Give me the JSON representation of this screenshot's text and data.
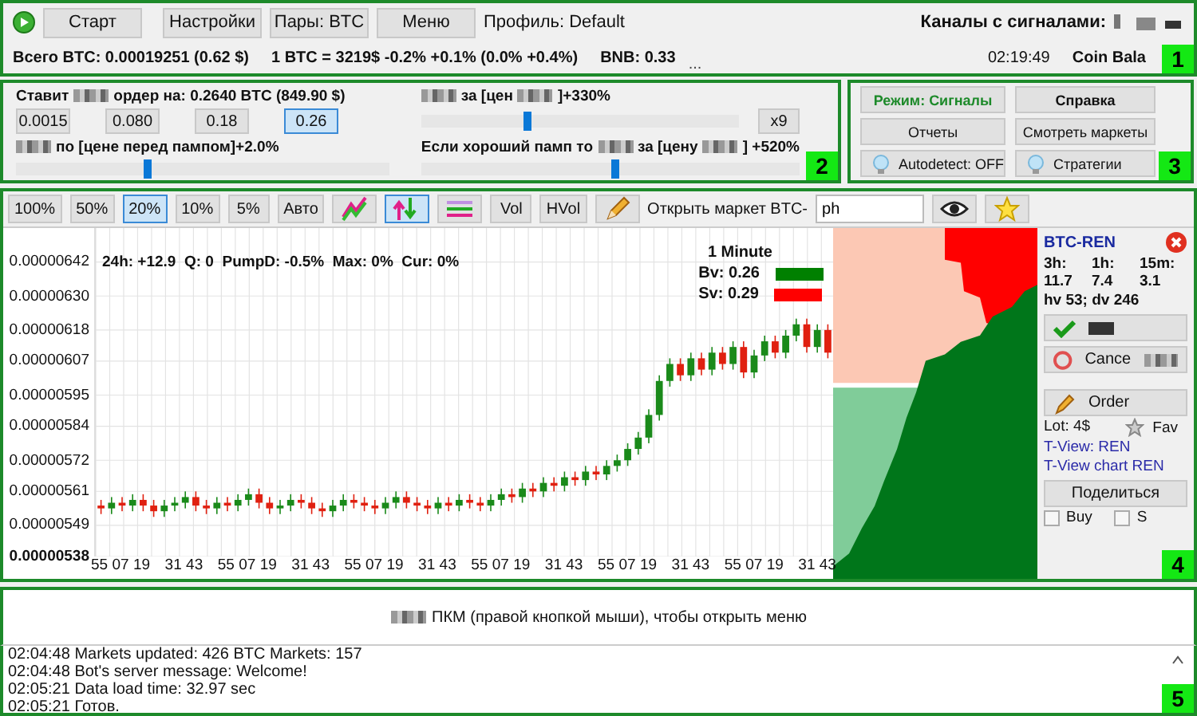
{
  "toolbar": {
    "buttons": [
      {
        "label": "Старт",
        "kind": "start"
      },
      {
        "label": "Настройки",
        "kind": "plain"
      },
      {
        "label": "Пары: BTC",
        "kind": "plain"
      },
      {
        "label": "Меню",
        "kind": "plain"
      }
    ],
    "profile": "Профиль: Default",
    "channels_label": "Каналы с сигналами:",
    "badge": "1"
  },
  "status_bar": {
    "items": [
      "Всего BTC: 0.00019251 (0.62 $)",
      "1 BTC = 3219$  -0.2% +0.1% (0.0% +0.4%)",
      "BNB: 0.33"
    ],
    "more": "...",
    "time": "02:19:49",
    "coin_balance": "Coin Bala"
  },
  "order_panel": {
    "amount_label": [
      {
        "kind": "text",
        "text": "Ставит"
      },
      {
        "kind": "redacted"
      },
      {
        "kind": "text",
        "text": "ордер на: 0.2640 BTC  (849.90 $)"
      }
    ],
    "amounts": [
      {
        "label": "0.0015",
        "selected": false
      },
      {
        "label": "0.080",
        "selected": false
      },
      {
        "label": "0.18",
        "selected": false
      },
      {
        "label": "0.26",
        "selected": true
      }
    ],
    "sell_label": [
      {
        "kind": "redacted"
      },
      {
        "kind": "text",
        "text": "по [цене перед пампом]+2.0%"
      }
    ],
    "sell_slider": {
      "level": 0.35
    },
    "target_label": [
      {
        "kind": "redacted"
      },
      {
        "kind": "text",
        "text": "за [цен"
      },
      {
        "kind": "redacted"
      },
      {
        "kind": "text",
        "text": "]+330%"
      }
    ],
    "target_slider": {
      "level": 0.33
    },
    "multiplier": "x9",
    "pump_label": [
      {
        "kind": "text",
        "text": "Если хороший памп  то"
      },
      {
        "kind": "redacted"
      },
      {
        "kind": "text",
        "text": "за [цену"
      },
      {
        "kind": "redacted"
      },
      {
        "kind": "text",
        "text": "] +520%"
      }
    ],
    "pump_slider": {
      "level": 0.51
    },
    "badge": "2"
  },
  "mode_panel": {
    "buttons": [
      {
        "label": "Режим: Сигналы",
        "kind": "mode"
      },
      {
        "label": "Справка",
        "kind": "bold"
      },
      {
        "label": "Отчеты",
        "kind": "plain"
      },
      {
        "label": "Смотреть маркеты",
        "kind": "plain"
      },
      {
        "label": "Autodetect: OFF",
        "kind": "bulb"
      },
      {
        "label": "Стратегии",
        "kind": "bulb"
      }
    ],
    "badge": "3"
  },
  "chart_toolbar": {
    "items": [
      {
        "kind": "text",
        "label": "100%",
        "selected": false
      },
      {
        "kind": "text",
        "label": "50%",
        "selected": false
      },
      {
        "kind": "text",
        "label": "20%",
        "selected": true
      },
      {
        "kind": "text",
        "label": "10%",
        "selected": false
      },
      {
        "kind": "text",
        "label": "5%",
        "selected": false
      },
      {
        "kind": "text",
        "label": "Авто",
        "selected": false
      },
      {
        "kind": "lines-icon",
        "selected": false
      },
      {
        "kind": "arrows-icon",
        "selected": true
      },
      {
        "kind": "bars-icon",
        "selected": false
      },
      {
        "kind": "bold",
        "label": "Vol",
        "selected": false
      },
      {
        "kind": "bold",
        "label": "HVol",
        "selected": false
      },
      {
        "kind": "pencil-icon",
        "selected": false
      }
    ],
    "open_market_label": "Открыть маркет BTC-",
    "market_value": "ph"
  },
  "chart": {
    "stats": "24h: +12.9  Q: 0  PumpD: -0.5%  Max: 0%  Cur: 0%",
    "interval": "1 Minute",
    "legend": [
      {
        "label": "Bv: 0.26",
        "color": "#008000"
      },
      {
        "label": "Sv: 0.29",
        "color": "#ff0000"
      }
    ],
    "chart_data": {
      "type": "candlestick",
      "grid": true,
      "ylim": [
        5.38e-06,
        6.54e-06
      ],
      "categories": [
        "55",
        null,
        "07",
        null,
        "19",
        null,
        null,
        "31",
        null,
        "43",
        null,
        null,
        "55",
        null,
        "07",
        null,
        "19",
        null,
        null,
        "31",
        null,
        "43",
        null,
        null,
        "55",
        null,
        "07",
        null,
        "19",
        null,
        null,
        "31",
        null,
        "43",
        null,
        null,
        "55",
        null,
        "07",
        null,
        "19",
        null,
        null,
        "31",
        null,
        "43",
        null,
        null,
        "55",
        null,
        "07",
        null,
        "19",
        null,
        null,
        "31",
        null,
        "43",
        null,
        null,
        "55",
        null,
        "07",
        null,
        "19",
        null,
        null,
        "31",
        null,
        "43"
      ],
      "ohlc": [
        [
          5.56e-06,
          5.58e-06,
          5.53e-06,
          5.55e-06
        ],
        [
          5.55e-06,
          5.59e-06,
          5.53e-06,
          5.57e-06
        ],
        [
          5.57e-06,
          5.59e-06,
          5.54e-06,
          5.56e-06
        ],
        [
          5.56e-06,
          5.6e-06,
          5.54e-06,
          5.58e-06
        ],
        [
          5.58e-06,
          5.6e-06,
          5.54e-06,
          5.56e-06
        ],
        [
          5.56e-06,
          5.58e-06,
          5.52e-06,
          5.54e-06
        ],
        [
          5.54e-06,
          5.58e-06,
          5.52e-06,
          5.56e-06
        ],
        [
          5.56e-06,
          5.59e-06,
          5.54e-06,
          5.57e-06
        ],
        [
          5.57e-06,
          5.61e-06,
          5.55e-06,
          5.59e-06
        ],
        [
          5.59e-06,
          5.61e-06,
          5.54e-06,
          5.56e-06
        ],
        [
          5.56e-06,
          5.58e-06,
          5.53e-06,
          5.55e-06
        ],
        [
          5.55e-06,
          5.59e-06,
          5.53e-06,
          5.57e-06
        ],
        [
          5.57e-06,
          5.59e-06,
          5.54e-06,
          5.56e-06
        ],
        [
          5.56e-06,
          5.6e-06,
          5.54e-06,
          5.58e-06
        ],
        [
          5.58e-06,
          5.62e-06,
          5.56e-06,
          5.6e-06
        ],
        [
          5.6e-06,
          5.62e-06,
          5.55e-06,
          5.57e-06
        ],
        [
          5.57e-06,
          5.59e-06,
          5.53e-06,
          5.55e-06
        ],
        [
          5.55e-06,
          5.58e-06,
          5.53e-06,
          5.56e-06
        ],
        [
          5.56e-06,
          5.6e-06,
          5.54e-06,
          5.58e-06
        ],
        [
          5.58e-06,
          5.6e-06,
          5.55e-06,
          5.57e-06
        ],
        [
          5.57e-06,
          5.59e-06,
          5.53e-06,
          5.55e-06
        ],
        [
          5.55e-06,
          5.57e-06,
          5.52e-06,
          5.54e-06
        ],
        [
          5.54e-06,
          5.58e-06,
          5.52e-06,
          5.56e-06
        ],
        [
          5.56e-06,
          5.6e-06,
          5.54e-06,
          5.58e-06
        ],
        [
          5.58e-06,
          5.6e-06,
          5.55e-06,
          5.57e-06
        ],
        [
          5.57e-06,
          5.59e-06,
          5.54e-06,
          5.56e-06
        ],
        [
          5.56e-06,
          5.58e-06,
          5.53e-06,
          5.55e-06
        ],
        [
          5.55e-06,
          5.59e-06,
          5.53e-06,
          5.57e-06
        ],
        [
          5.57e-06,
          5.61e-06,
          5.55e-06,
          5.59e-06
        ],
        [
          5.59e-06,
          5.61e-06,
          5.55e-06,
          5.57e-06
        ],
        [
          5.57e-06,
          5.59e-06,
          5.54e-06,
          5.56e-06
        ],
        [
          5.56e-06,
          5.58e-06,
          5.53e-06,
          5.55e-06
        ],
        [
          5.55e-06,
          5.59e-06,
          5.53e-06,
          5.57e-06
        ],
        [
          5.57e-06,
          5.59e-06,
          5.54e-06,
          5.56e-06
        ],
        [
          5.56e-06,
          5.6e-06,
          5.54e-06,
          5.58e-06
        ],
        [
          5.58e-06,
          5.6e-06,
          5.55e-06,
          5.57e-06
        ],
        [
          5.57e-06,
          5.59e-06,
          5.54e-06,
          5.56e-06
        ],
        [
          5.56e-06,
          5.6e-06,
          5.54e-06,
          5.58e-06
        ],
        [
          5.58e-06,
          5.62e-06,
          5.56e-06,
          5.6e-06
        ],
        [
          5.6e-06,
          5.62e-06,
          5.57e-06,
          5.59e-06
        ],
        [
          5.59e-06,
          5.64e-06,
          5.57e-06,
          5.62e-06
        ],
        [
          5.62e-06,
          5.64e-06,
          5.59e-06,
          5.61e-06
        ],
        [
          5.61e-06,
          5.66e-06,
          5.59e-06,
          5.64e-06
        ],
        [
          5.64e-06,
          5.66e-06,
          5.61e-06,
          5.63e-06
        ],
        [
          5.63e-06,
          5.68e-06,
          5.61e-06,
          5.66e-06
        ],
        [
          5.66e-06,
          5.68e-06,
          5.63e-06,
          5.65e-06
        ],
        [
          5.65e-06,
          5.7e-06,
          5.63e-06,
          5.68e-06
        ],
        [
          5.68e-06,
          5.7e-06,
          5.65e-06,
          5.67e-06
        ],
        [
          5.67e-06,
          5.72e-06,
          5.65e-06,
          5.7e-06
        ],
        [
          5.7e-06,
          5.74e-06,
          5.68e-06,
          5.72e-06
        ],
        [
          5.72e-06,
          5.78e-06,
          5.7e-06,
          5.76e-06
        ],
        [
          5.76e-06,
          5.82e-06,
          5.74e-06,
          5.8e-06
        ],
        [
          5.8e-06,
          5.9e-06,
          5.78e-06,
          5.88e-06
        ],
        [
          5.88e-06,
          6.02e-06,
          5.86e-06,
          6e-06
        ],
        [
          6e-06,
          6.08e-06,
          5.98e-06,
          6.06e-06
        ],
        [
          6.06e-06,
          6.08e-06,
          6e-06,
          6.02e-06
        ],
        [
          6.02e-06,
          6.1e-06,
          6e-06,
          6.08e-06
        ],
        [
          6.08e-06,
          6.1e-06,
          6.02e-06,
          6.04e-06
        ],
        [
          6.04e-06,
          6.12e-06,
          6.02e-06,
          6.1e-06
        ],
        [
          6.1e-06,
          6.12e-06,
          6.04e-06,
          6.06e-06
        ],
        [
          6.06e-06,
          6.14e-06,
          6.04e-06,
          6.12e-06
        ],
        [
          6.12e-06,
          6.14e-06,
          6.01e-06,
          6.03e-06
        ],
        [
          6.03e-06,
          6.11e-06,
          6.01e-06,
          6.09e-06
        ],
        [
          6.09e-06,
          6.16e-06,
          6.07e-06,
          6.14e-06
        ],
        [
          6.14e-06,
          6.16e-06,
          6.08e-06,
          6.1e-06
        ],
        [
          6.1e-06,
          6.18e-06,
          6.08e-06,
          6.16e-06
        ],
        [
          6.16e-06,
          6.22e-06,
          6.14e-06,
          6.2e-06
        ],
        [
          6.2e-06,
          6.22e-06,
          6.1e-06,
          6.12e-06
        ],
        [
          6.12e-06,
          6.2e-06,
          6.1e-06,
          6.18e-06
        ],
        [
          6.18e-06,
          6.2e-06,
          6.08e-06,
          6.1e-06
        ]
      ],
      "yticks": [
        {
          "value": 6.42e-06,
          "label": "0.00000642"
        },
        {
          "value": 6.3e-06,
          "label": "0.00000630"
        },
        {
          "value": 6.18e-06,
          "label": "0.00000618"
        },
        {
          "value": 6.07e-06,
          "label": "0.00000607"
        },
        {
          "value": 5.95e-06,
          "label": "0.00000595"
        },
        {
          "value": 5.84e-06,
          "label": "0.00000584"
        },
        {
          "value": 5.72e-06,
          "label": "0.00000572"
        },
        {
          "value": 5.61e-06,
          "label": "0.00000561"
        },
        {
          "value": 5.49e-06,
          "label": "0.00000549"
        },
        {
          "value": 5.38e-06,
          "label": "0.00000538"
        }
      ]
    }
  },
  "market_panel": {
    "title": "BTC-REN",
    "stats_heads": [
      "3h:",
      "1h:",
      "15m:"
    ],
    "stats_values": [
      "11.7",
      "7.4",
      "3.1"
    ],
    "volume": "hv 53; dv 246",
    "cancel": "Cance",
    "order": "Order",
    "lot": "Lot: 4$",
    "fav": "Fav",
    "links": [
      "T-View: REN",
      "T-View chart REN"
    ],
    "share": "Поделиться",
    "checks": [
      {
        "label": "Buy",
        "checked": false
      },
      {
        "label": "S",
        "checked": false
      }
    ],
    "badge": "4"
  },
  "hint": "ПКМ (правой кнопкой мыши), чтобы открыть меню",
  "log": {
    "lines": [
      "02:04:48  Markets updated: 426  BTC Markets: 157",
      "02:04:48  Bot's server message: Welcome!",
      "02:05:21  Data load time: 32.97 sec",
      "02:05:21  Готов."
    ],
    "badge": "5"
  }
}
